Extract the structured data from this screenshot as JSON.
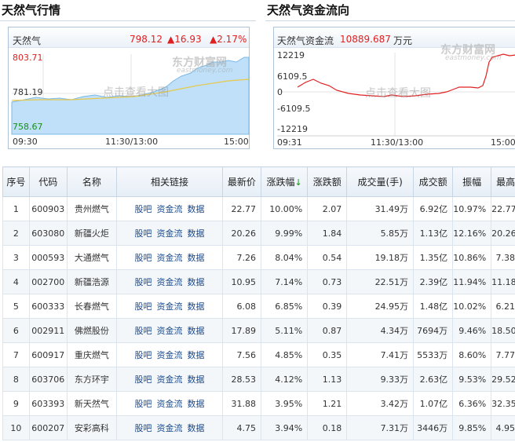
{
  "left": {
    "section_title": "天然气行情",
    "name": "天然气",
    "price": "798.12",
    "change": "▲16.93",
    "change_pct": "▲2.17%",
    "y_high": "803.71",
    "y_mid": "781.19",
    "y_low": "758.67",
    "x_start": "09:30",
    "x_mid": "11:30/13:00",
    "x_end": "15:00",
    "watermark": "点击查看大图",
    "logo": "东方财富网",
    "logo_sub": "eastmoney.com"
  },
  "right": {
    "section_title": "天然气资金流向",
    "name": "天然气资金流",
    "value": "10889.687",
    "unit": "万元",
    "y1": "12219",
    "y2": "6109.5",
    "y3": "0",
    "y4": "-6109.5",
    "y5": "-12219",
    "x_start": "09:31",
    "x_mid": "11:30/13:00",
    "x_end": "15:00",
    "watermark": "点击查看大图",
    "logo": "东方财富网",
    "logo_sub": "eastmoney.com"
  },
  "colors": {
    "up": "#e02020",
    "down": "#17901a",
    "link": "#1a4a8a",
    "area": "#bfe0f8",
    "avg_line": "#e8c84a"
  },
  "table": {
    "headers": [
      "序号",
      "代码",
      "名称",
      "相关链接",
      "最新价",
      "涨跌幅",
      "涨跌额",
      "成交量(手)",
      "成交额",
      "振幅",
      "最高"
    ],
    "sort_arrow": "↓",
    "link_labels": [
      "股吧",
      "资金流",
      "数据"
    ],
    "rows": [
      {
        "idx": "1",
        "code": "600903",
        "name": "贵州燃气",
        "price": "22.77",
        "pct": "10.00%",
        "chg": "2.07",
        "vol": "31.49万",
        "amt": "6.92亿",
        "amp": "10.97%",
        "high": "22.77"
      },
      {
        "idx": "2",
        "code": "603080",
        "name": "新疆火炬",
        "price": "20.26",
        "pct": "9.99%",
        "chg": "1.84",
        "vol": "5.85万",
        "amt": "1.13亿",
        "amp": "12.16%",
        "high": "20.26"
      },
      {
        "idx": "3",
        "code": "000593",
        "name": "大通燃气",
        "price": "7.26",
        "pct": "8.04%",
        "chg": "0.54",
        "vol": "19.18万",
        "amt": "1.35亿",
        "amp": "10.86%",
        "high": "7.38"
      },
      {
        "idx": "4",
        "code": "002700",
        "name": "新疆浩源",
        "price": "10.95",
        "pct": "7.14%",
        "chg": "0.73",
        "vol": "22.51万",
        "amt": "2.39亿",
        "amp": "11.94%",
        "high": "11.18"
      },
      {
        "idx": "5",
        "code": "600333",
        "name": "长春燃气",
        "price": "6.08",
        "pct": "6.85%",
        "chg": "0.39",
        "vol": "24.95万",
        "amt": "1.48亿",
        "amp": "10.02%",
        "high": "6.21"
      },
      {
        "idx": "6",
        "code": "002911",
        "name": "佛燃股份",
        "price": "17.89",
        "pct": "5.11%",
        "chg": "0.87",
        "vol": "4.34万",
        "amt": "7694万",
        "amp": "9.46%",
        "high": "18.50"
      },
      {
        "idx": "7",
        "code": "600917",
        "name": "重庆燃气",
        "price": "7.56",
        "pct": "4.85%",
        "chg": "0.35",
        "vol": "7.41万",
        "amt": "5533万",
        "amp": "8.60%",
        "high": "7.77"
      },
      {
        "idx": "8",
        "code": "603706",
        "name": "东方环宇",
        "price": "28.53",
        "pct": "4.12%",
        "chg": "1.13",
        "vol": "9.33万",
        "amt": "2.63亿",
        "amp": "9.53%",
        "high": "29.52"
      },
      {
        "idx": "9",
        "code": "603393",
        "name": "新天然气",
        "price": "31.88",
        "pct": "3.95%",
        "chg": "1.21",
        "vol": "3.42万",
        "amt": "1.07亿",
        "amp": "6.36%",
        "high": "32.35"
      },
      {
        "idx": "10",
        "code": "600207",
        "name": "安彩高科",
        "price": "4.75",
        "pct": "3.94%",
        "chg": "0.18",
        "vol": "7.31万",
        "amt": "3446万",
        "amp": "9.85%",
        "high": "4.95"
      }
    ]
  }
}
